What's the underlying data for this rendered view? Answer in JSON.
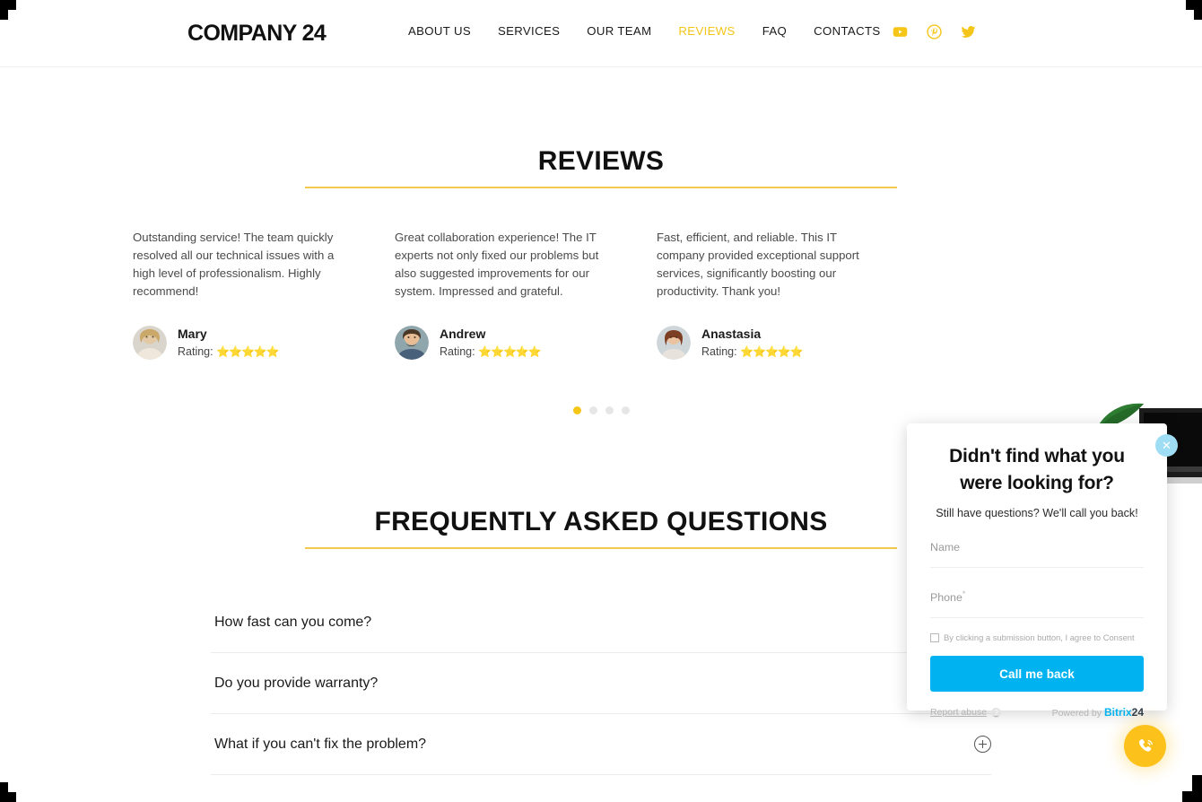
{
  "header": {
    "logo": "COMPANY 24",
    "nav": [
      {
        "label": "ABOUT US",
        "active": false
      },
      {
        "label": "SERVICES",
        "active": false
      },
      {
        "label": "OUR TEAM",
        "active": false
      },
      {
        "label": "REVIEWS",
        "active": true
      },
      {
        "label": "FAQ",
        "active": false
      },
      {
        "label": "CONTACTS",
        "active": false
      }
    ],
    "socials": [
      "youtube-icon",
      "pinterest-icon",
      "twitter-icon"
    ],
    "accent_color": "#f5c518"
  },
  "reviews": {
    "title": "REVIEWS",
    "items": [
      {
        "text": "Outstanding service! The team quickly resolved all our technical issues with a high level of professionalism. Highly recommend!",
        "name": "Mary",
        "rating_label": "Rating:",
        "stars": "⭐⭐⭐⭐⭐"
      },
      {
        "text": "Great collaboration experience! The IT experts not only fixed our problems but also suggested improvements for our system. Impressed and grateful.",
        "name": "Andrew",
        "rating_label": "Rating:",
        "stars": "⭐⭐⭐⭐⭐"
      },
      {
        "text": "Fast, efficient, and reliable. This IT company provided exceptional support services, significantly boosting our productivity. Thank you!",
        "name": "Anastasia",
        "rating_label": "Rating:",
        "stars": "⭐⭐⭐⭐⭐"
      }
    ],
    "carousel_dots": 4,
    "carousel_active_index": 0
  },
  "faq": {
    "title": "FREQUENTLY ASKED QUESTIONS",
    "items": [
      {
        "question": "How fast can you come?"
      },
      {
        "question": "Do you provide warranty?"
      },
      {
        "question": "What if you can't fix the problem?"
      }
    ]
  },
  "popup": {
    "title": "Didn't find what you were looking for?",
    "subtitle": "Still have questions? We'll call you back!",
    "close_label": "✕",
    "fields": [
      {
        "label": "Name",
        "required": false,
        "value": "",
        "placeholder": "Name"
      },
      {
        "label": "Phone",
        "required": true,
        "value": "",
        "placeholder": "Phone"
      }
    ],
    "required_mark": "*",
    "consent_text": "By clicking a submission button, I agree to Consent",
    "consent_checked": false,
    "submit_label": "Call me back",
    "report_label": "Report abuse",
    "help_label": "?",
    "powered_prefix": "Powered by",
    "powered_brand": "Bitrix",
    "powered_brand_num": "24",
    "button_color": "#00b3f0"
  },
  "call_fab": {
    "icon": "phone-icon",
    "color": "#fcc21b"
  }
}
